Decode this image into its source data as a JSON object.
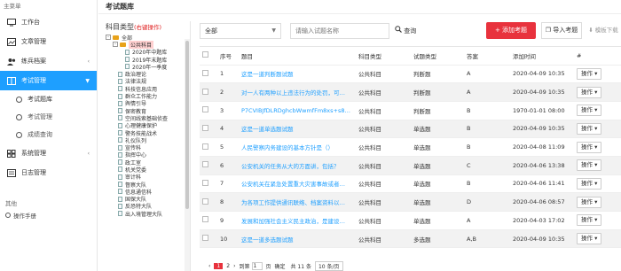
{
  "sidebar": {
    "menu_title": "主菜单",
    "items": [
      {
        "label": "工作台"
      },
      {
        "label": "文章管理"
      },
      {
        "label": "练兵档案"
      },
      {
        "label": "考试管理"
      },
      {
        "label": "系统管理"
      },
      {
        "label": "日志管理"
      }
    ],
    "sub_items": [
      {
        "label": "考试题库"
      },
      {
        "label": "考试管理"
      },
      {
        "label": "成绩查询"
      }
    ],
    "other_title": "其他",
    "manual": "操作手册"
  },
  "main": {
    "page_title": "考试题库",
    "tree": {
      "title": "科目类型",
      "hint": "(右键操作)",
      "root": "全部",
      "nodes": [
        "公共科目",
        "2020年中题库",
        "2019年末题库",
        "2020年一季度",
        "政治理论",
        "法律法规",
        "科技信息应用",
        "群众工作能力",
        "舆情引导",
        "保密教育",
        "空间线索基础侦查",
        "心理健康保护",
        "警务技能战术",
        "礼仪队列",
        "宣传科",
        "指挥中心",
        "政工室",
        "机关党委",
        "审计科",
        "督察大队",
        "信息通信科",
        "国保大队",
        "反恐特大队",
        "出入境管理大队"
      ]
    },
    "toolbar": {
      "select_value": "全部",
      "search_placeholder": "请输入试题名称",
      "search_label": "查询",
      "add_label": "添加考题",
      "import_label": "导入考题",
      "template_label": "模板下载"
    },
    "table": {
      "headers": [
        "序号",
        "题目",
        "科目类型",
        "试题类型",
        "答案",
        "添加时间",
        "#"
      ],
      "op_label": "操作",
      "rows": [
        {
          "no": "1",
          "title": "这是一道判断题试题",
          "subject": "公共科目",
          "type": "判断题",
          "answer": "A",
          "time": "2020-04-09 10:35"
        },
        {
          "no": "2",
          "title": "对一人有两种以上违法行为的处罚，可…",
          "subject": "公共科目",
          "type": "判断题",
          "answer": "A",
          "time": "2020-04-09 10:35"
        },
        {
          "no": "3",
          "title": "P7CVIBJfDLRDghcbWwmfFm8xs+s8e…",
          "subject": "公共科目",
          "type": "判断题",
          "answer": "B",
          "time": "1970-01-01 08:00"
        },
        {
          "no": "4",
          "title": "这是一道单选题试题",
          "subject": "公共科目",
          "type": "单选题",
          "answer": "B",
          "time": "2020-04-09 10:35"
        },
        {
          "no": "5",
          "title": "人民警察内务建设的基本方针是（）",
          "subject": "公共科目",
          "type": "单选题",
          "answer": "B",
          "time": "2020-04-08 11:09"
        },
        {
          "no": "6",
          "title": "公安机关的任务从大的方面讲，包括？",
          "subject": "公共科目",
          "type": "单选题",
          "answer": "C",
          "time": "2020-04-06 13:38"
        },
        {
          "no": "7",
          "title": "公安机关在紧急处置重大灾害事故或者…",
          "subject": "公共科目",
          "type": "单选题",
          "answer": "B",
          "time": "2020-04-06 11:41"
        },
        {
          "no": "8",
          "title": "为各项工作提供通讯联络、档案资料以…",
          "subject": "公共科目",
          "type": "单选题",
          "answer": "D",
          "time": "2020-04-06 08:57"
        },
        {
          "no": "9",
          "title": "发展和加强社会主义民主政治，是建设…",
          "subject": "公共科目",
          "type": "单选题",
          "answer": "A",
          "time": "2020-04-03 17:02"
        },
        {
          "no": "10",
          "title": "这是一道多选题试题",
          "subject": "公共科目",
          "type": "多选题",
          "answer": "A,B",
          "time": "2020-04-09 10:35"
        }
      ]
    },
    "pager": {
      "current": "1",
      "next": "2",
      "goto_label": "到第",
      "page_input": "1",
      "page_suffix": "页",
      "confirm": "确定",
      "total": "共 11 条",
      "per_page": "10 条/页"
    }
  }
}
